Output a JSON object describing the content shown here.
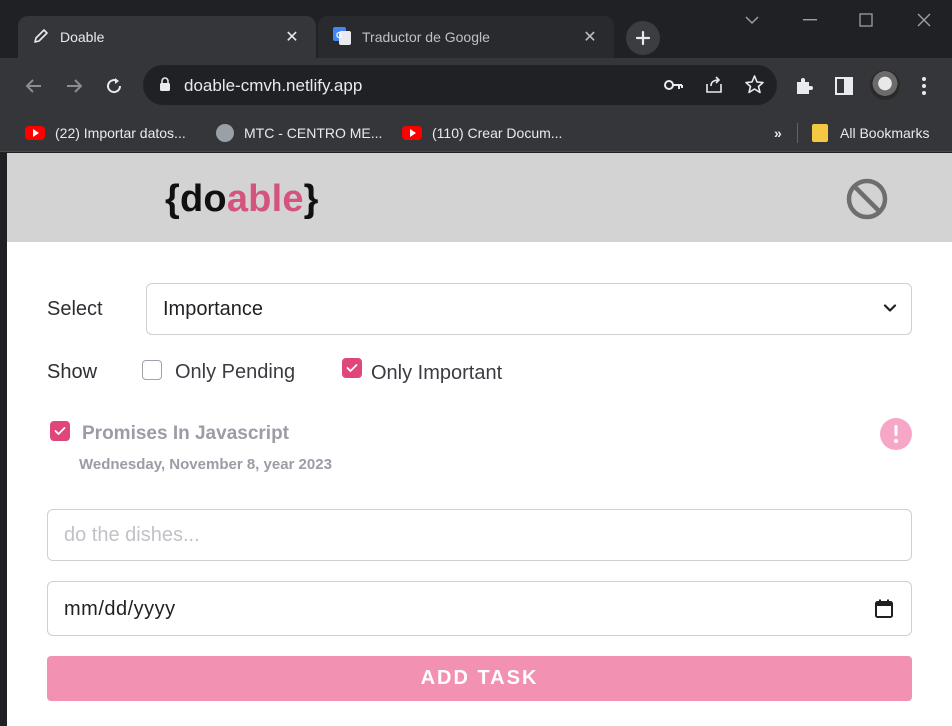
{
  "browser": {
    "tabs": [
      {
        "title": "Doable",
        "active": true,
        "icon": "pencil-icon"
      },
      {
        "title": "Traductor de Google",
        "active": false,
        "icon": "google-translate-icon"
      }
    ],
    "url": "doable-cmvh.netlify.app",
    "bookmarks": [
      {
        "label": "(22) Importar datos...",
        "icon": "youtube-icon"
      },
      {
        "label": "MTC - CENTRO ME...",
        "icon": "globe-icon"
      },
      {
        "label": "(110) Crear Docum...",
        "icon": "youtube-icon"
      }
    ],
    "bookmarks_overflow": "»",
    "all_bookmarks": "All Bookmarks"
  },
  "app": {
    "logo": {
      "open": "{",
      "part1": "do",
      "part2": "able",
      "close": "}"
    },
    "accent_color": "#d4547e",
    "filters": {
      "select_label": "Select",
      "select_value": "Importance",
      "show_label": "Show",
      "only_pending_label": "Only Pending",
      "only_pending_checked": false,
      "only_important_label": "Only Important",
      "only_important_checked": true
    },
    "tasks": [
      {
        "title": "Promises In Javascript",
        "date": "Wednesday, November 8, year 2023",
        "done": true,
        "important": true
      }
    ],
    "form": {
      "task_placeholder": "do the dishes...",
      "date_placeholder": "mm/dd/yyyy",
      "add_button": "ADD TASK"
    }
  }
}
